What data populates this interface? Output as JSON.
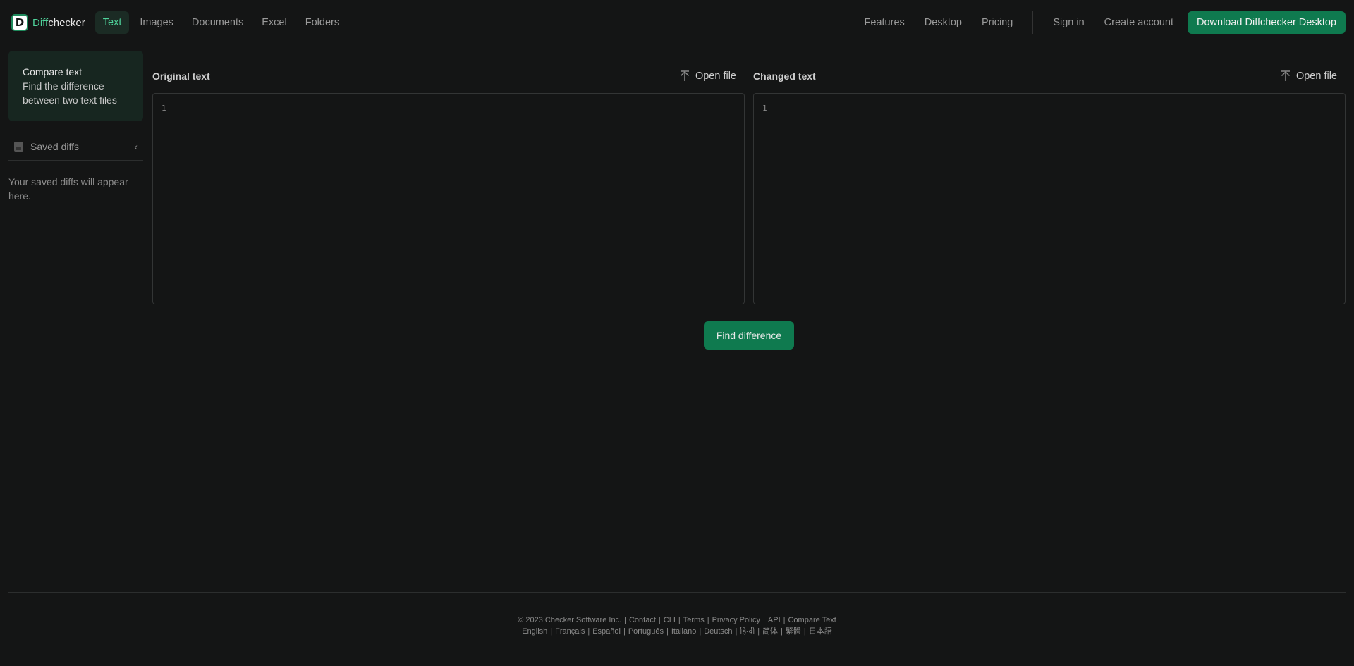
{
  "brand": {
    "logo_letter": "D",
    "name_accent": "Diff",
    "name_rest": "checker"
  },
  "nav": {
    "left": [
      "Text",
      "Images",
      "Documents",
      "Excel",
      "Folders"
    ],
    "right": [
      "Features",
      "Desktop",
      "Pricing"
    ],
    "sign_in": "Sign in",
    "create_account": "Create account",
    "download": "Download Diffchecker Desktop"
  },
  "sidebar": {
    "card_title": "Compare text",
    "card_sub": "Find the difference between two text files",
    "saved_label": "Saved diffs",
    "saved_empty": "Your saved diffs will appear here."
  },
  "left_panel": {
    "title": "Original text",
    "open_file": "Open file",
    "line": "1"
  },
  "right_panel": {
    "title": "Changed text",
    "open_file": "Open file",
    "line": "1"
  },
  "find_button": "Find difference",
  "footer": {
    "row1": [
      "© 2023 Checker Software Inc.",
      "Contact",
      "CLI",
      "Terms",
      "Privacy Policy",
      "API",
      "Compare Text"
    ],
    "row2": [
      "English",
      "Français",
      "Español",
      "Português",
      "Italiano",
      "Deutsch",
      "हिन्दी",
      "简体",
      "繁體",
      "日本語"
    ]
  },
  "colors": {
    "accent": "#4fd39b",
    "button": "#0f7a4f",
    "background": "#141515"
  }
}
